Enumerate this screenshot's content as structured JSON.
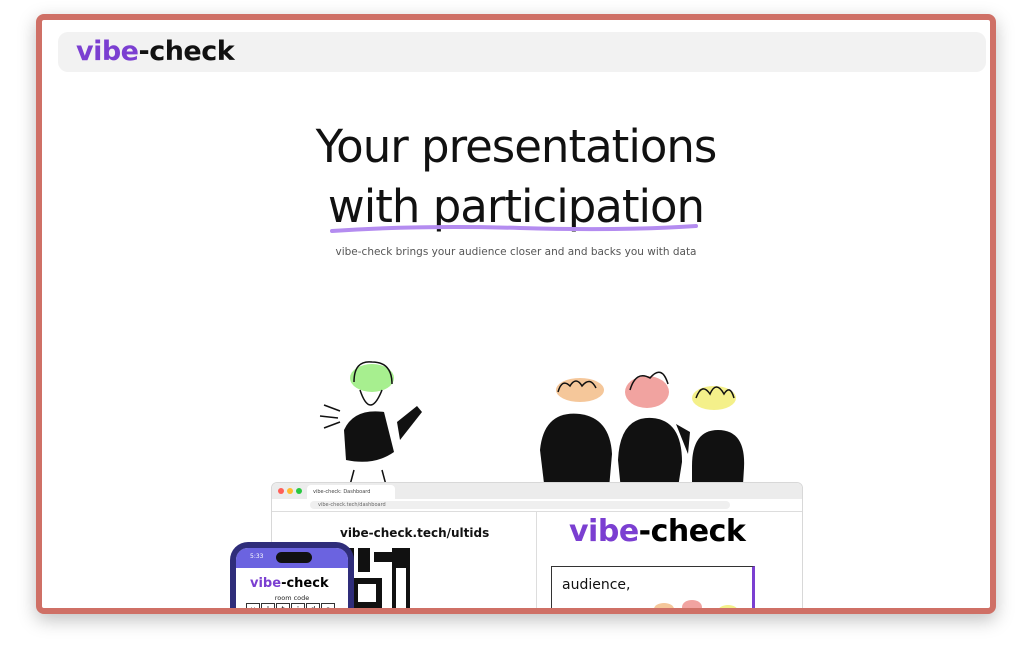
{
  "nav": {
    "logo_part1": "vibe",
    "logo_part2": "-check"
  },
  "hero": {
    "title_line1": "Your presentations",
    "title_line2": "with participation",
    "subtitle": "vibe-check brings your audience closer and and backs you with data"
  },
  "browser": {
    "tab_title": "vibe-check: Dashboard",
    "url": "vibe-check.tech/dashboard",
    "room_url": "vibe-check.tech/ultids",
    "logo_part1": "vibe",
    "logo_part2": "-check",
    "card_text": "audience,"
  },
  "phone": {
    "time": "5:33",
    "logo_part1": "vibe",
    "logo_part2": "-check",
    "room_code_label": "room code",
    "room_code_letters": [
      "u",
      "l",
      "t",
      "i",
      "d",
      "s"
    ]
  },
  "colors": {
    "accent": "#7b3fd1",
    "frame": "#cf7066",
    "underline": "#b48cf0"
  }
}
